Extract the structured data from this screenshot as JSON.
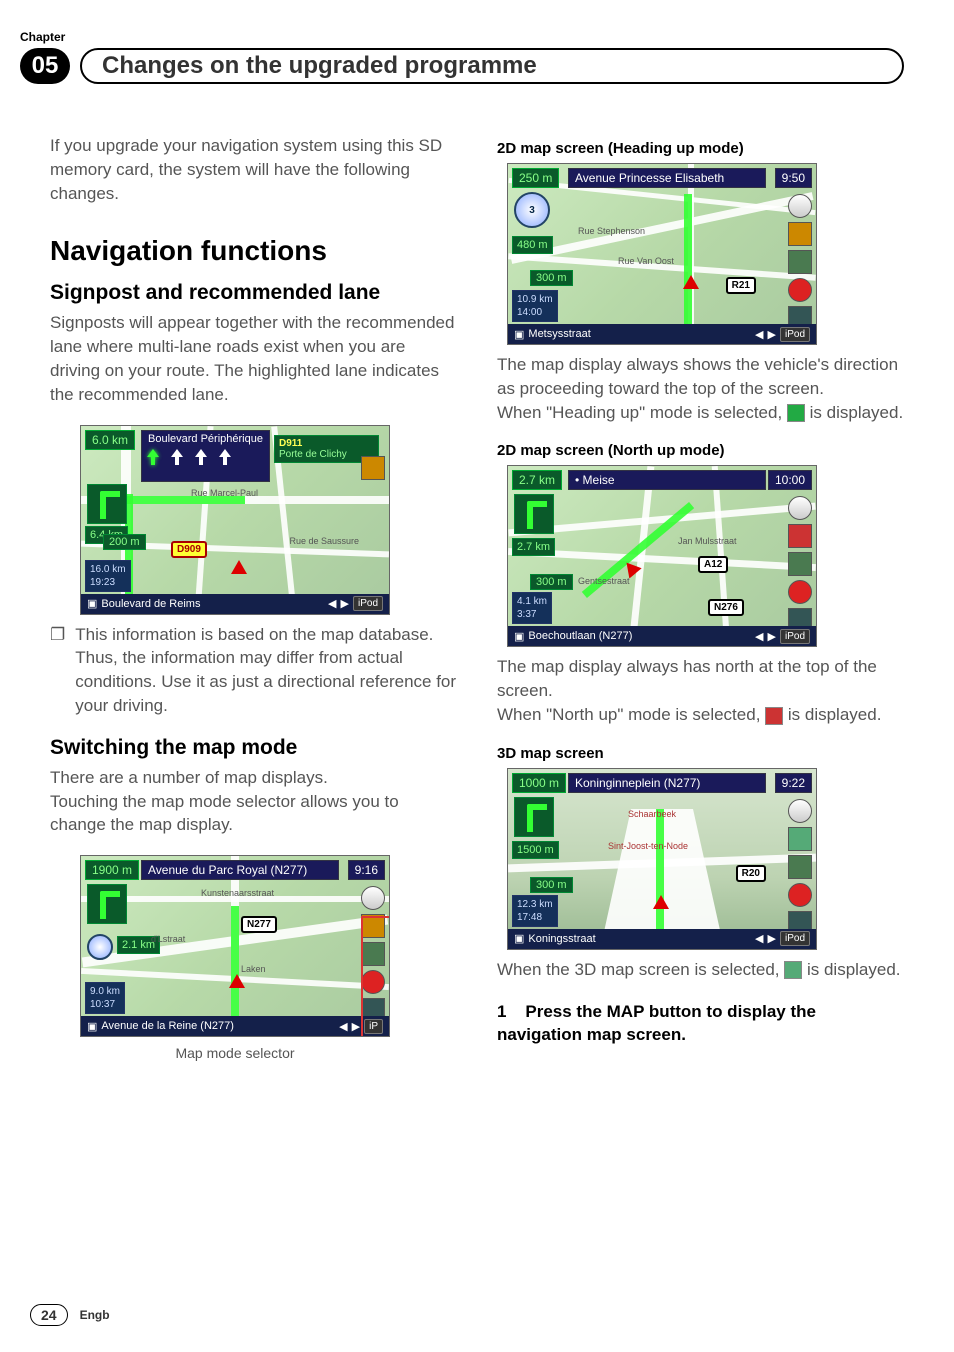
{
  "chapter": {
    "label": "Chapter",
    "number": "05"
  },
  "page_title": "Changes on the upgraded programme",
  "intro": "If you upgrade your navigation system using this SD memory card, the system will have the following changes.",
  "nav_heading": "Navigation functions",
  "signpost": {
    "heading": "Signpost and recommended lane",
    "body": "Signposts will appear together with the recommended lane where multi-lane roads exist when you are driving on your route. The highlighted lane indicates the recommended lane.",
    "note": "This information is based on the map database. Thus, the information may differ from actual conditions. Use it as just a directional reference for your driving."
  },
  "switch": {
    "heading": "Switching the map mode",
    "body1": "There are a number of map displays.",
    "body2": "Touching the map mode selector allows you to change the map display.",
    "caption": "Map mode selector"
  },
  "heading2d": {
    "label": "2D map screen (Heading up mode)",
    "body1": "The map display always shows the vehicle's direction as proceeding toward the top of the screen.",
    "body2a": "When \"Heading up\" mode is selected, ",
    "body2b": " is displayed."
  },
  "north2d": {
    "label": "2D map screen (North up mode)",
    "body1": "The map display always has north at the top of the screen.",
    "body2a": "When \"North up\" mode is selected, ",
    "body2b": " is displayed."
  },
  "map3d": {
    "label": "3D map screen",
    "body1a": "When the 3D map screen is selected, ",
    "body1b": " is displayed."
  },
  "instruction": {
    "num": "1",
    "text": "Press the MAP button to display the navigation map screen."
  },
  "footer": {
    "page": "24",
    "lang": "Engb"
  },
  "maps": {
    "signpost": {
      "top_dist": "6.0 km",
      "lane_title": "Boulevard Périphérique",
      "lane_sub_code": "D911",
      "lane_sub_text": "Porte de Clichy",
      "sub_dist": "6.4 km",
      "pill": "200 m",
      "shield": "D909",
      "stat1": "16.0 km",
      "stat2": "19:23",
      "bottom": "Boulevard de Reims",
      "ipod": "iPod",
      "street1": "Rue Marcel-Paul",
      "street2": "Rue de Saussure"
    },
    "selector": {
      "top_dist": "1900 m",
      "top_title": "Avenue du Parc Royal (N277)",
      "top_time": "9:16",
      "sub_dist": "2.1 km",
      "shield": "N277",
      "stat1": "9.0 km",
      "stat2": "10:37",
      "bottom": "Avenue de la Reine (N277)",
      "street1": "Kunstenaarsstraat",
      "street2": "d'Lstraat",
      "street3": "Laken"
    },
    "heading2d": {
      "top_dist": "250 m",
      "top_title": "Avenue Princesse Elisabeth",
      "top_time": "9:50",
      "sub_dist": "480 m",
      "compass": "3",
      "pill": "300 m",
      "shield": "R21",
      "stat1": "10.9 km",
      "stat2": "14:00",
      "bottom": "Metsysstraat",
      "ipod": "iPod",
      "street1": "Rue Stephenson",
      "street2": "Rue Van Oost"
    },
    "north2d": {
      "top_dist": "2.7 km",
      "top_title": "• Meise",
      "top_time": "10:00",
      "sub_dist": "2.7 km",
      "pill": "300 m",
      "shield1": "A12",
      "shield2": "N276",
      "stat1": "4.1 km",
      "stat2": "3:37",
      "bottom": "Boechoutlaan (N277)",
      "ipod": "iPod",
      "street1": "Jan Mulsstraat",
      "street2": "Gentsestraat"
    },
    "map3d": {
      "top_dist": "1000 m",
      "top_title": "Koninginneplein (N277)",
      "top_time": "9:22",
      "sub_dist": "1500 m",
      "pill": "300 m",
      "shield": "R20",
      "stat1": "12.3 km",
      "stat2": "17:48",
      "bottom": "Koningsstraat",
      "ipod": "iPod",
      "street1": "Schaarbeek",
      "street2": "Sint-Joost-ten-Node"
    }
  }
}
